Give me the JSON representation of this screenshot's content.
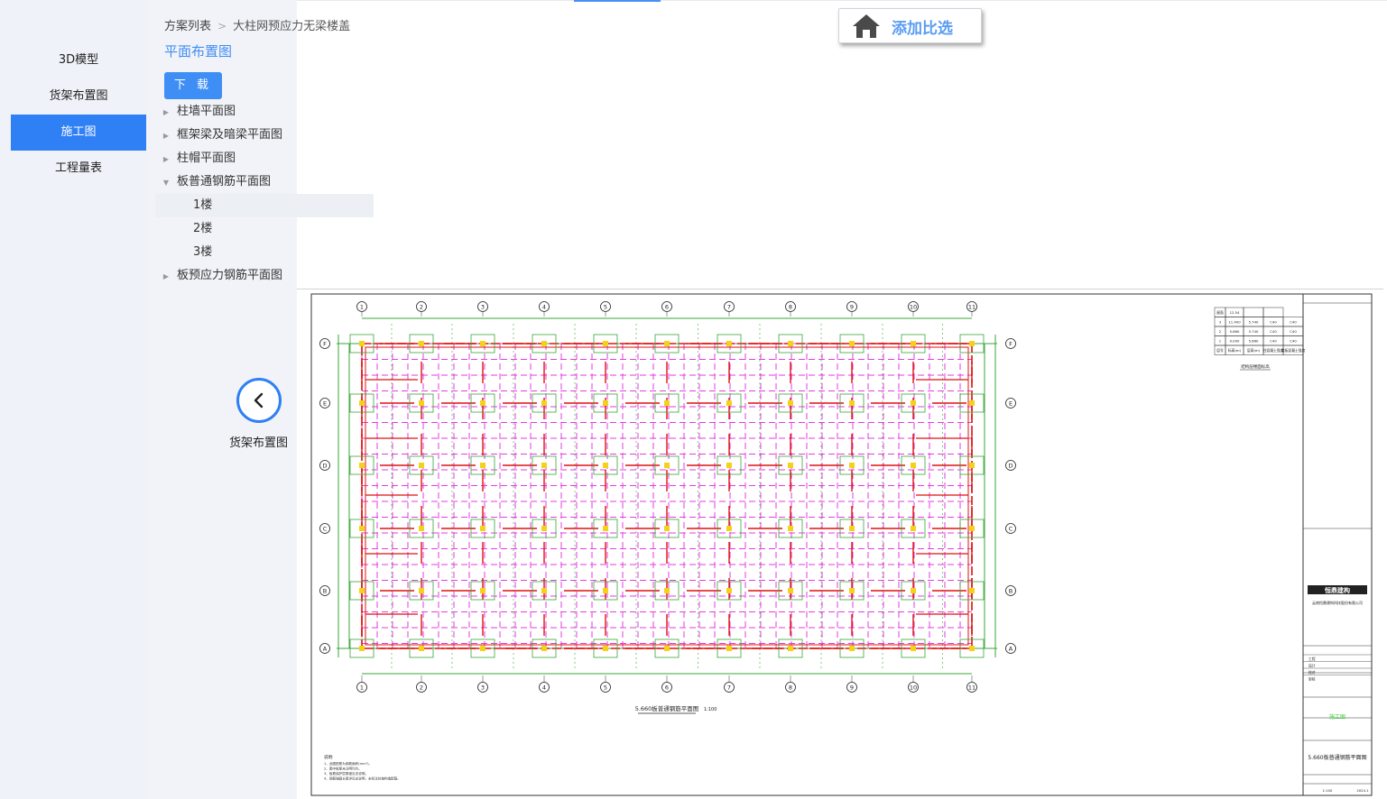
{
  "nav": {
    "items": [
      {
        "label": "3D模型",
        "active": false
      },
      {
        "label": "货架布置图",
        "active": false
      },
      {
        "label": "施工图",
        "active": true
      },
      {
        "label": "工程量表",
        "active": false
      }
    ]
  },
  "breadcrumb": {
    "root": "方案列表",
    "current": "大柱网预应力无梁楼盖"
  },
  "page_title": "平面布置图",
  "download_label": "下 载",
  "tree": [
    {
      "label": "柱墙平面图",
      "expanded": false
    },
    {
      "label": "框架梁及暗梁平面图",
      "expanded": false
    },
    {
      "label": "柱帽平面图",
      "expanded": false
    },
    {
      "label": "板普通钢筋平面图",
      "expanded": true
    },
    {
      "label": "1楼",
      "child": true,
      "selected": true
    },
    {
      "label": "2楼",
      "child": true
    },
    {
      "label": "3楼",
      "child": true
    },
    {
      "label": "板预应力钢筋平面图",
      "expanded": false
    }
  ],
  "collapse_label": "货架布置图",
  "add_compare_label": "添加比选",
  "drawing": {
    "column_axes": [
      "1",
      "2",
      "3",
      "4",
      "5",
      "6",
      "7",
      "8",
      "9",
      "10",
      "11"
    ],
    "row_axes": [
      "F",
      "E",
      "D",
      "C",
      "B",
      "A"
    ],
    "plan_title": "5.660板普通钢筋平面图",
    "plan_scale": "1:100",
    "table_title": "结构层楼面标高",
    "table_rows": [
      [
        "屋面",
        "12.54",
        "",
        ""
      ],
      [
        "3",
        "11.400",
        "5.740",
        "C40",
        "C40"
      ],
      [
        "2",
        "5.660",
        "5.740",
        "C40",
        "C40"
      ],
      [
        "1",
        "0.000",
        "5.660",
        "C40",
        "C40"
      ],
      [
        "层号",
        "标高(m)",
        "层高(m)",
        "柱混凝土强度",
        "梁板混凝土强度"
      ]
    ],
    "notes_title": "说明:",
    "notes": [
      "1、此图配筋为钢筋面积(mm²)。",
      "2、图中板厚未注明均为。",
      "3、板筋保护层厚度见总说明。",
      "4、钢筋锚固长度详见总说明，未标注处按构造配筋。"
    ],
    "title_block": {
      "company_logo": "恒鼎建构",
      "company": "云南恒鼎建构科技股份有限公司",
      "stamp": "施工图",
      "drawing_name": "5.660板普通钢筋平面图",
      "scale": "1:100",
      "date": "2024.1",
      "rows": [
        "工程",
        "设计",
        "校对",
        "审核"
      ]
    },
    "colors": {
      "grid": "#3aa53a",
      "pink": "#e33de0",
      "red": "#e01010",
      "yellow": "#f3d21a"
    }
  }
}
